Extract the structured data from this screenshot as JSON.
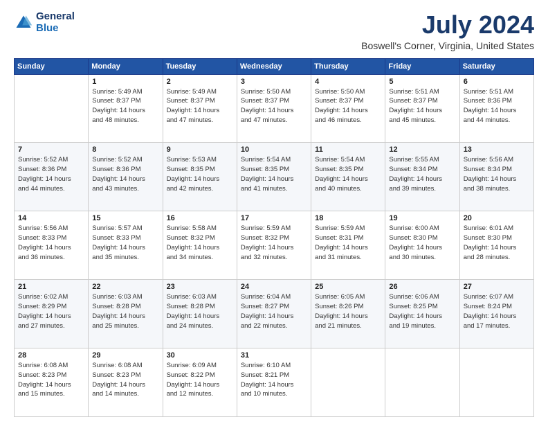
{
  "logo": {
    "general": "General",
    "blue": "Blue"
  },
  "header": {
    "month": "July 2024",
    "location": "Boswell's Corner, Virginia, United States"
  },
  "days_of_week": [
    "Sunday",
    "Monday",
    "Tuesday",
    "Wednesday",
    "Thursday",
    "Friday",
    "Saturday"
  ],
  "weeks": [
    [
      {
        "day": "",
        "info": ""
      },
      {
        "day": "1",
        "info": "Sunrise: 5:49 AM\nSunset: 8:37 PM\nDaylight: 14 hours\nand 48 minutes."
      },
      {
        "day": "2",
        "info": "Sunrise: 5:49 AM\nSunset: 8:37 PM\nDaylight: 14 hours\nand 47 minutes."
      },
      {
        "day": "3",
        "info": "Sunrise: 5:50 AM\nSunset: 8:37 PM\nDaylight: 14 hours\nand 47 minutes."
      },
      {
        "day": "4",
        "info": "Sunrise: 5:50 AM\nSunset: 8:37 PM\nDaylight: 14 hours\nand 46 minutes."
      },
      {
        "day": "5",
        "info": "Sunrise: 5:51 AM\nSunset: 8:37 PM\nDaylight: 14 hours\nand 45 minutes."
      },
      {
        "day": "6",
        "info": "Sunrise: 5:51 AM\nSunset: 8:36 PM\nDaylight: 14 hours\nand 44 minutes."
      }
    ],
    [
      {
        "day": "7",
        "info": "Sunrise: 5:52 AM\nSunset: 8:36 PM\nDaylight: 14 hours\nand 44 minutes."
      },
      {
        "day": "8",
        "info": "Sunrise: 5:52 AM\nSunset: 8:36 PM\nDaylight: 14 hours\nand 43 minutes."
      },
      {
        "day": "9",
        "info": "Sunrise: 5:53 AM\nSunset: 8:35 PM\nDaylight: 14 hours\nand 42 minutes."
      },
      {
        "day": "10",
        "info": "Sunrise: 5:54 AM\nSunset: 8:35 PM\nDaylight: 14 hours\nand 41 minutes."
      },
      {
        "day": "11",
        "info": "Sunrise: 5:54 AM\nSunset: 8:35 PM\nDaylight: 14 hours\nand 40 minutes."
      },
      {
        "day": "12",
        "info": "Sunrise: 5:55 AM\nSunset: 8:34 PM\nDaylight: 14 hours\nand 39 minutes."
      },
      {
        "day": "13",
        "info": "Sunrise: 5:56 AM\nSunset: 8:34 PM\nDaylight: 14 hours\nand 38 minutes."
      }
    ],
    [
      {
        "day": "14",
        "info": "Sunrise: 5:56 AM\nSunset: 8:33 PM\nDaylight: 14 hours\nand 36 minutes."
      },
      {
        "day": "15",
        "info": "Sunrise: 5:57 AM\nSunset: 8:33 PM\nDaylight: 14 hours\nand 35 minutes."
      },
      {
        "day": "16",
        "info": "Sunrise: 5:58 AM\nSunset: 8:32 PM\nDaylight: 14 hours\nand 34 minutes."
      },
      {
        "day": "17",
        "info": "Sunrise: 5:59 AM\nSunset: 8:32 PM\nDaylight: 14 hours\nand 32 minutes."
      },
      {
        "day": "18",
        "info": "Sunrise: 5:59 AM\nSunset: 8:31 PM\nDaylight: 14 hours\nand 31 minutes."
      },
      {
        "day": "19",
        "info": "Sunrise: 6:00 AM\nSunset: 8:30 PM\nDaylight: 14 hours\nand 30 minutes."
      },
      {
        "day": "20",
        "info": "Sunrise: 6:01 AM\nSunset: 8:30 PM\nDaylight: 14 hours\nand 28 minutes."
      }
    ],
    [
      {
        "day": "21",
        "info": "Sunrise: 6:02 AM\nSunset: 8:29 PM\nDaylight: 14 hours\nand 27 minutes."
      },
      {
        "day": "22",
        "info": "Sunrise: 6:03 AM\nSunset: 8:28 PM\nDaylight: 14 hours\nand 25 minutes."
      },
      {
        "day": "23",
        "info": "Sunrise: 6:03 AM\nSunset: 8:28 PM\nDaylight: 14 hours\nand 24 minutes."
      },
      {
        "day": "24",
        "info": "Sunrise: 6:04 AM\nSunset: 8:27 PM\nDaylight: 14 hours\nand 22 minutes."
      },
      {
        "day": "25",
        "info": "Sunrise: 6:05 AM\nSunset: 8:26 PM\nDaylight: 14 hours\nand 21 minutes."
      },
      {
        "day": "26",
        "info": "Sunrise: 6:06 AM\nSunset: 8:25 PM\nDaylight: 14 hours\nand 19 minutes."
      },
      {
        "day": "27",
        "info": "Sunrise: 6:07 AM\nSunset: 8:24 PM\nDaylight: 14 hours\nand 17 minutes."
      }
    ],
    [
      {
        "day": "28",
        "info": "Sunrise: 6:08 AM\nSunset: 8:23 PM\nDaylight: 14 hours\nand 15 minutes."
      },
      {
        "day": "29",
        "info": "Sunrise: 6:08 AM\nSunset: 8:23 PM\nDaylight: 14 hours\nand 14 minutes."
      },
      {
        "day": "30",
        "info": "Sunrise: 6:09 AM\nSunset: 8:22 PM\nDaylight: 14 hours\nand 12 minutes."
      },
      {
        "day": "31",
        "info": "Sunrise: 6:10 AM\nSunset: 8:21 PM\nDaylight: 14 hours\nand 10 minutes."
      },
      {
        "day": "",
        "info": ""
      },
      {
        "day": "",
        "info": ""
      },
      {
        "day": "",
        "info": ""
      }
    ]
  ]
}
